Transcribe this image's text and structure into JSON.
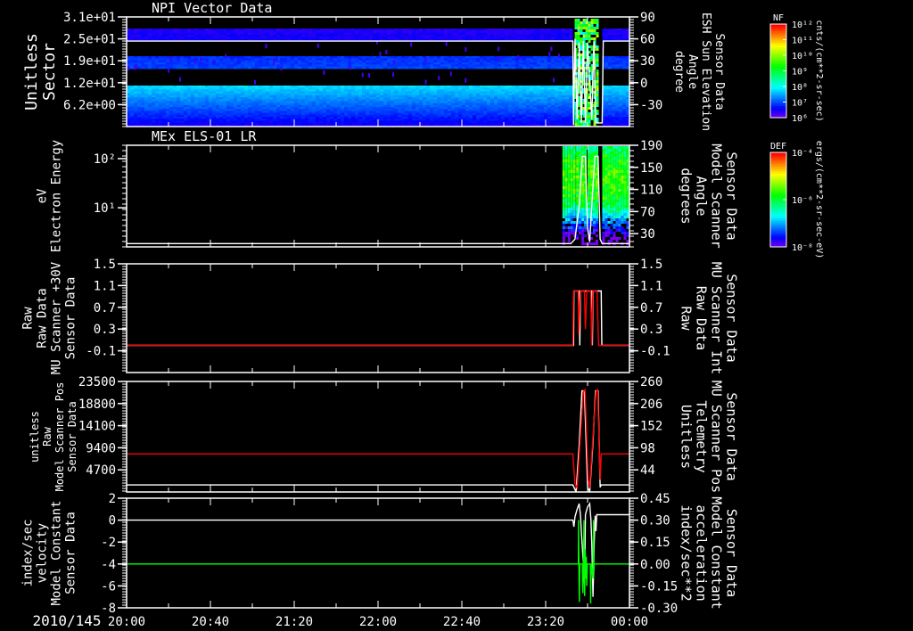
{
  "date_label": "2010/145",
  "time_axis": {
    "unit": "minutes since 20:00",
    "ticks": [
      {
        "value": 0,
        "label": "20:00"
      },
      {
        "value": 40,
        "label": "20:40"
      },
      {
        "value": 80,
        "label": "21:20"
      },
      {
        "value": 120,
        "label": "22:00"
      },
      {
        "value": 160,
        "label": "22:40"
      },
      {
        "value": 200,
        "label": "23:20"
      },
      {
        "value": 240,
        "label": "00:00"
      }
    ],
    "range": [
      0,
      240
    ]
  },
  "colorbars": [
    {
      "title": "NF",
      "units": "cnts/(cm**2-sr-sec)",
      "ticks": [
        "10¹²",
        "10¹¹",
        "10¹⁰",
        "10⁹",
        "10⁸",
        "10⁷",
        "10⁶"
      ]
    },
    {
      "title": "DEF",
      "units": "ergs/(cm**2-sr-sec-eV)",
      "ticks": [
        "10⁻⁴",
        "10⁻⁶",
        "10⁻⁸"
      ]
    }
  ],
  "colors": {
    "axis": "#ffffff",
    "red": "#ff0000",
    "green": "#00ff00",
    "white": "#ffffff"
  },
  "chart_data": [
    {
      "type": "heatmap",
      "title": "NPI Vector Data",
      "left_axis": {
        "label": [
          "Sector",
          "Unitless"
        ],
        "scale": "linear",
        "range": [
          0,
          31
        ],
        "ticks": [
          {
            "value": 31,
            "label": "3.1e+01"
          },
          {
            "value": 24.8,
            "label": "2.5e+01"
          },
          {
            "value": 18.6,
            "label": "1.9e+01"
          },
          {
            "value": 12.4,
            "label": "1.2e+01"
          },
          {
            "value": 6.2,
            "label": "6.2e+00"
          }
        ]
      },
      "right_axis": {
        "label": [
          "Sensor Data",
          "ESH Sun Elevation",
          "Angle",
          "degree"
        ],
        "color": "#ffffff",
        "scale": "linear",
        "range": [
          -60,
          90
        ],
        "ticks": [
          {
            "value": 90,
            "label": "90"
          },
          {
            "value": 60,
            "label": "60"
          },
          {
            "value": 30,
            "label": "30"
          },
          {
            "value": 0,
            "label": "0"
          },
          {
            "value": -30,
            "label": "-30"
          }
        ]
      },
      "bands": [
        {
          "from": 24.2,
          "to": 27.7,
          "level_from": 0.08,
          "level_to": 0.1
        },
        {
          "from": 16.4,
          "to": 19.9,
          "level_from": 0.15,
          "level_to": 0.17
        },
        {
          "from": 0,
          "to": 11.6,
          "level_from": 0.3,
          "level_to": 0.08
        }
      ],
      "event_window": [
        213,
        227
      ],
      "lines": [
        {
          "name": "ESH Sun Elevation",
          "axis": "right",
          "color": "#ffffff",
          "points": [
            [
              0,
              57
            ],
            [
              213,
              57
            ],
            [
              213.3,
              -58
            ],
            [
              214,
              60
            ],
            [
              215,
              -50
            ],
            [
              216,
              55
            ],
            [
              217,
              -55
            ],
            [
              218,
              57
            ],
            [
              219,
              -55
            ],
            [
              220,
              55
            ],
            [
              222,
              -50
            ],
            [
              223,
              57
            ],
            [
              224,
              -55
            ],
            [
              227,
              -55
            ],
            [
              227.5,
              57
            ],
            [
              240,
              57
            ]
          ]
        }
      ]
    },
    {
      "type": "heatmap",
      "title": "MEx ELS-01 LR",
      "left_axis": {
        "label": [
          "Electron Energy",
          "eV"
        ],
        "scale": "log",
        "range": [
          1.6,
          187
        ],
        "ticks": [
          {
            "value": 100,
            "label": "10²"
          },
          {
            "value": 10,
            "label": "10¹"
          }
        ]
      },
      "right_axis": {
        "label": [
          "Sensor Data",
          "Model Scanner",
          "Angle",
          "degrees"
        ],
        "color": "#ffffff",
        "scale": "linear",
        "range": [
          6,
          190
        ],
        "ticks": [
          {
            "value": 190,
            "label": "190"
          },
          {
            "value": 150,
            "label": "150"
          },
          {
            "value": 110,
            "label": "110"
          },
          {
            "value": 70,
            "label": "70"
          },
          {
            "value": 30,
            "label": "30"
          }
        ]
      },
      "data_segments": [
        [
          208,
          213.5
        ],
        [
          214.5,
          218.5
        ],
        [
          220,
          224.5
        ],
        [
          227,
          240
        ]
      ],
      "lines": [
        {
          "name": "Model Scanner Angle",
          "axis": "right",
          "color": "#ffffff",
          "points": [
            [
              0,
              12
            ],
            [
              212,
              12
            ],
            [
              214,
              20
            ],
            [
              216,
              80
            ],
            [
              217.5,
              170
            ],
            [
              219,
              170
            ],
            [
              220,
              40
            ],
            [
              221,
              15
            ],
            [
              222,
              80
            ],
            [
              223.5,
              170
            ],
            [
              225,
              170
            ],
            [
              226,
              20
            ],
            [
              227,
              12
            ],
            [
              240,
              12
            ]
          ]
        }
      ]
    },
    {
      "type": "line",
      "left_axis": {
        "label": [
          "Sensor Data",
          "MU Scanner +30V",
          "Raw Data",
          "Raw"
        ],
        "scale": "linear",
        "range": [
          -0.5,
          1.5
        ],
        "ticks": [
          {
            "value": 1.5,
            "label": "1.5"
          },
          {
            "value": 1.1,
            "label": "1.1"
          },
          {
            "value": 0.7,
            "label": "0.7"
          },
          {
            "value": 0.3,
            "label": "0.3"
          },
          {
            "value": -0.1,
            "label": "-0.1"
          }
        ]
      },
      "right_axis": {
        "label": [
          "Sensor Data",
          "MU Scanner Int",
          "Raw Data",
          "Raw"
        ],
        "color": "#ff0000",
        "scale": "linear",
        "range": [
          -0.5,
          1.5
        ],
        "ticks": [
          {
            "value": 1.5,
            "label": "1.5"
          },
          {
            "value": 1.1,
            "label": "1.1"
          },
          {
            "value": 0.7,
            "label": "0.7"
          },
          {
            "value": 0.3,
            "label": "0.3"
          },
          {
            "value": -0.1,
            "label": "-0.1"
          }
        ]
      },
      "lines": [
        {
          "name": "MU Scanner +30V",
          "axis": "left",
          "color": "#ffffff",
          "points": [
            [
              0,
              0
            ],
            [
              213.3,
              0
            ],
            [
              213.5,
              1
            ],
            [
              216,
              1
            ],
            [
              216.3,
              0
            ],
            [
              216.6,
              1
            ],
            [
              222,
              1
            ],
            [
              222.3,
              0
            ],
            [
              222.6,
              1
            ],
            [
              226.5,
              1
            ],
            [
              226.8,
              0
            ],
            [
              240,
              0
            ]
          ]
        },
        {
          "name": "MU Scanner Int",
          "axis": "right",
          "color": "#ff0000",
          "points": [
            [
              0,
              0
            ],
            [
              213,
              0
            ],
            [
              213.3,
              1
            ],
            [
              215.5,
              1
            ],
            [
              215.8,
              0.2
            ],
            [
              216.5,
              1
            ],
            [
              218.5,
              1
            ],
            [
              219,
              0.3
            ],
            [
              219.6,
              1
            ],
            [
              221.5,
              1
            ],
            [
              222,
              0
            ],
            [
              222.5,
              1
            ],
            [
              224.5,
              1
            ],
            [
              225,
              0.3
            ],
            [
              225.3,
              0
            ],
            [
              240,
              0
            ]
          ]
        }
      ]
    },
    {
      "type": "line",
      "left_axis": {
        "label": [
          "Sensor Data",
          "Model Scanner Pos",
          "Raw",
          "unitless"
        ],
        "scale": "linear",
        "range": [
          0,
          23500
        ],
        "ticks": [
          {
            "value": 23500,
            "label": "23500"
          },
          {
            "value": 18800,
            "label": "18800"
          },
          {
            "value": 14100,
            "label": "14100"
          },
          {
            "value": 9400,
            "label": "9400"
          },
          {
            "value": 4700,
            "label": "4700"
          }
        ]
      },
      "right_axis": {
        "label": [
          "Sensor Data",
          "MU Scanner Pos",
          "Telemetry",
          "Unitless"
        ],
        "color": "#ff0000",
        "scale": "linear",
        "range": [
          -10,
          260
        ],
        "ticks": [
          {
            "value": 260,
            "label": "260"
          },
          {
            "value": 206,
            "label": "206"
          },
          {
            "value": 152,
            "label": "152"
          },
          {
            "value": 98,
            "label": "98"
          },
          {
            "value": 44,
            "label": "44"
          }
        ]
      },
      "lines": [
        {
          "name": "Model Scanner Pos",
          "axis": "left",
          "color": "#ffffff",
          "points": [
            [
              0,
              1500
            ],
            [
              213,
              1500
            ],
            [
              214.5,
              0
            ],
            [
              216,
              10000
            ],
            [
              217.3,
              21500
            ],
            [
              218.5,
              21500
            ],
            [
              220,
              1000
            ],
            [
              221,
              0
            ],
            [
              222.5,
              10000
            ],
            [
              223.8,
              21500
            ],
            [
              225,
              21500
            ],
            [
              226,
              1000
            ],
            [
              226.5,
              1500
            ],
            [
              240,
              1500
            ]
          ]
        },
        {
          "name": "MU Scanner Pos Telemetry",
          "axis": "right",
          "color": "#ff0000",
          "points": [
            [
              0,
              83
            ],
            [
              213,
              83
            ],
            [
              214,
              10
            ],
            [
              215,
              0
            ],
            [
              216.5,
              120
            ],
            [
              218,
              235
            ],
            [
              218.8,
              240
            ],
            [
              220.3,
              20
            ],
            [
              221,
              0
            ],
            [
              222.5,
              120
            ],
            [
              224,
              235
            ],
            [
              224.8,
              240
            ],
            [
              226,
              20
            ],
            [
              226.5,
              83
            ],
            [
              240,
              83
            ]
          ]
        }
      ]
    },
    {
      "type": "line",
      "left_axis": {
        "label": [
          "Sensor Data",
          "Model Constant",
          "velocity",
          "index/sec"
        ],
        "scale": "linear",
        "range": [
          -8,
          2
        ],
        "ticks": [
          {
            "value": 2,
            "label": "2"
          },
          {
            "value": 0,
            "label": "0"
          },
          {
            "value": -2,
            "label": "-2"
          },
          {
            "value": -4,
            "label": "-4"
          },
          {
            "value": -6,
            "label": "-6"
          },
          {
            "value": -8,
            "label": "-8"
          }
        ]
      },
      "right_axis": {
        "label": [
          "Sensor Data",
          "Model Constant",
          "acceleration",
          "index/sec**2"
        ],
        "color": "#00ff00",
        "scale": "linear",
        "range": [
          -0.3,
          0.45
        ],
        "ticks": [
          {
            "value": 0.45,
            "label": "0.45"
          },
          {
            "value": 0.3,
            "label": "0.30"
          },
          {
            "value": 0.15,
            "label": "0.15"
          },
          {
            "value": 0.0,
            "label": "0.00"
          },
          {
            "value": -0.15,
            "label": "-0.15"
          },
          {
            "value": -0.3,
            "label": "-0.30"
          }
        ]
      },
      "lines": [
        {
          "name": "Model Constant velocity",
          "axis": "left",
          "color": "#ffffff",
          "points": [
            [
              0,
              0
            ],
            [
              213,
              0
            ],
            [
              213.5,
              -0.6
            ],
            [
              214,
              0.3
            ],
            [
              215,
              1
            ],
            [
              216,
              1.5
            ],
            [
              216.6,
              0.5
            ],
            [
              217,
              -1
            ],
            [
              218,
              -4
            ],
            [
              218.6,
              -6
            ],
            [
              219,
              0.5
            ],
            [
              220,
              1.2
            ],
            [
              221,
              1.5
            ],
            [
              221.6,
              0
            ],
            [
              222,
              -2
            ],
            [
              222.6,
              -7
            ],
            [
              223.2,
              -2
            ],
            [
              223.6,
              0.4
            ],
            [
              224,
              -1
            ],
            [
              224.4,
              0.5
            ],
            [
              240,
              0.5
            ]
          ]
        },
        {
          "name": "Model Constant acceleration",
          "axis": "right",
          "color": "#00ff00",
          "points": [
            [
              0,
              0
            ],
            [
              215.6,
              0
            ],
            [
              215.7,
              0.3
            ],
            [
              215.9,
              -0.1
            ],
            [
              216.1,
              -0.26
            ],
            [
              216.3,
              0
            ],
            [
              217.5,
              0
            ],
            [
              217.6,
              -0.15
            ],
            [
              217.8,
              -0.2
            ],
            [
              218.3,
              0.3
            ],
            [
              218.6,
              -0.22
            ],
            [
              218.9,
              0.1
            ],
            [
              219.1,
              -0.1
            ],
            [
              219.4,
              0.05
            ],
            [
              219.6,
              -0.15
            ],
            [
              219.9,
              0
            ],
            [
              221.3,
              0
            ],
            [
              221.5,
              -0.27
            ],
            [
              221.7,
              0
            ],
            [
              222.6,
              -0.1
            ],
            [
              222.8,
              0.3
            ],
            [
              223,
              -0.05
            ],
            [
              223.2,
              0
            ],
            [
              240,
              0
            ]
          ]
        }
      ]
    }
  ]
}
